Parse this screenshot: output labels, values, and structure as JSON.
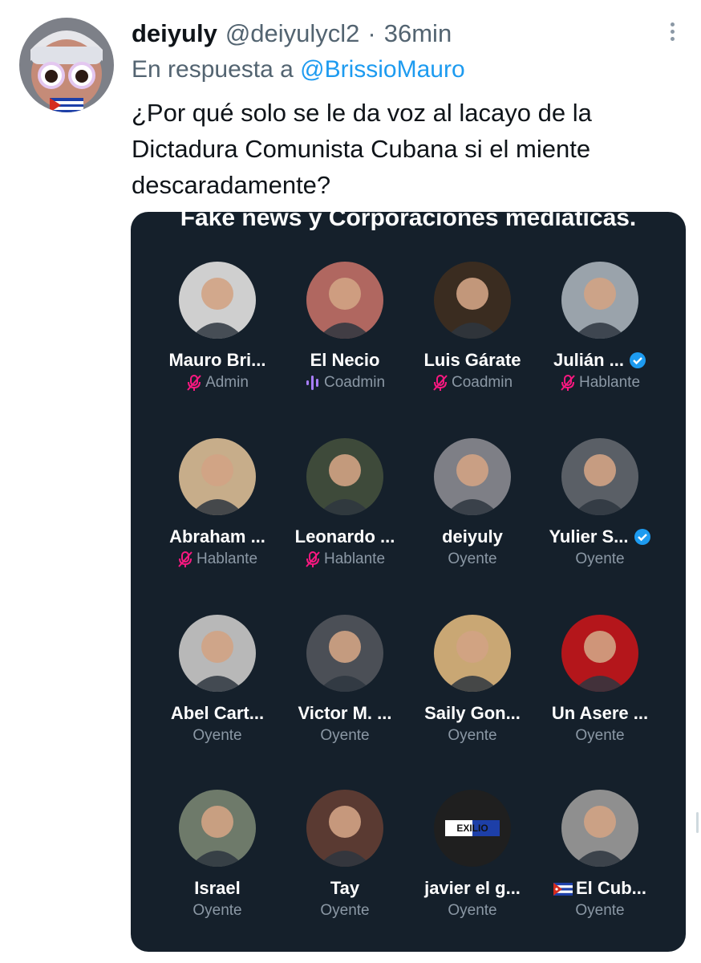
{
  "tweet": {
    "display_name": "deiyuly",
    "handle": "@deiyulycl2",
    "separator": "·",
    "time": "36min",
    "reply_prefix": "En respuesta a",
    "reply_to": "@BrissioMauro",
    "text": "¿Por qué solo se le da voz al lacayo de la Dictadura Comunista Cubana si el miente descaradamente?"
  },
  "space": {
    "title": "Fake news y Corporaciones mediáticas.",
    "participants": [
      {
        "name": "Mauro Bri...",
        "role": "Admin",
        "role_icon": "mic-muted-icon",
        "verified": false,
        "avatar_color": "#cfcfcf"
      },
      {
        "name": "El Necio",
        "role": "Coadmin",
        "role_icon": "speaking-waveform-icon",
        "verified": false,
        "avatar_color": "#b06760"
      },
      {
        "name": "Luis Gárate",
        "role": "Coadmin",
        "role_icon": "mic-muted-icon",
        "verified": false,
        "avatar_color": "#3a2c20"
      },
      {
        "name": "Julián ...",
        "role": "Hablante",
        "role_icon": "mic-muted-icon",
        "verified": true,
        "avatar_color": "#9aa3ab"
      },
      {
        "name": "Abraham ...",
        "role": "Hablante",
        "role_icon": "mic-muted-icon",
        "verified": false,
        "avatar_color": "#c7ad8a"
      },
      {
        "name": "Leonardo ...",
        "role": "Hablante",
        "role_icon": "mic-muted-icon",
        "verified": false,
        "avatar_color": "#3e4a3a"
      },
      {
        "name": "deiyuly",
        "role": "Oyente",
        "role_icon": "",
        "verified": false,
        "avatar_color": "#7e7f86"
      },
      {
        "name": "Yulier S...",
        "role": "Oyente",
        "role_icon": "",
        "verified": true,
        "avatar_color": "#5a5f66"
      },
      {
        "name": "Abel Cart...",
        "role": "Oyente",
        "role_icon": "",
        "verified": false,
        "avatar_color": "#b8b8b8"
      },
      {
        "name": "Victor M. ...",
        "role": "Oyente",
        "role_icon": "",
        "verified": false,
        "avatar_color": "#4b4f56"
      },
      {
        "name": "Saily Gon...",
        "role": "Oyente",
        "role_icon": "",
        "verified": false,
        "avatar_color": "#c9a774"
      },
      {
        "name": "Un Asere ...",
        "role": "Oyente",
        "role_icon": "",
        "verified": false,
        "avatar_color": "#b4161b"
      },
      {
        "name": "Israel",
        "role": "Oyente",
        "role_icon": "",
        "verified": false,
        "avatar_color": "#6e7a6a"
      },
      {
        "name": "Tay",
        "role": "Oyente",
        "role_icon": "",
        "verified": false,
        "avatar_color": "#5a3a32"
      },
      {
        "name": "javier el g...",
        "role": "Oyente",
        "role_icon": "",
        "verified": false,
        "avatar_color": "#1f1f1f",
        "avatar_text": "EXILIO"
      },
      {
        "name": "El Cub...",
        "role": "Oyente",
        "role_icon": "",
        "verified": false,
        "avatar_color": "#8f8f8f",
        "name_prefix_flag": "cuban-flag-emoji"
      }
    ]
  },
  "colors": {
    "card_bg": "#15202b",
    "link": "#1d9bf0",
    "muted_text": "#8b98a5",
    "mic_muted": "#f91880",
    "speaking": "#a97eff",
    "verified": "#1d9bf0"
  }
}
